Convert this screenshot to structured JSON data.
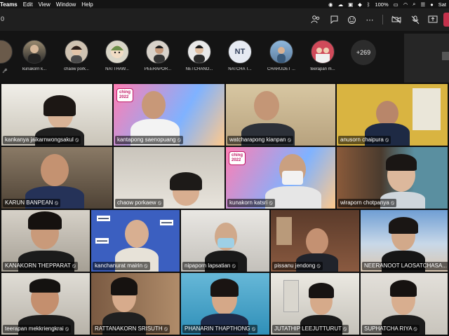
{
  "menubar": {
    "app": "Teams",
    "items": [
      "Edit",
      "View",
      "Window",
      "Help"
    ],
    "battery": "100%",
    "time": "Sat"
  },
  "toolbar": {
    "timer": "0"
  },
  "attendees": [
    {
      "name": "kunakorn k..."
    },
    {
      "name": "chaow pork..."
    },
    {
      "name": "NATTHAW..."
    },
    {
      "name": "PEERAPOR..."
    },
    {
      "name": "NETCHANO..."
    },
    {
      "name": "NATCHA T...",
      "initials": "NT"
    },
    {
      "name": "CHARUDET ..."
    },
    {
      "name": "teerapan m..."
    }
  ],
  "more_count": "+269",
  "badge": {
    "line1": "ching",
    "line2": "2022"
  },
  "tiles": [
    {
      "name": "kankanya jaikarnwongsakul"
    },
    {
      "name": "kantapong saenopuang"
    },
    {
      "name": "watcharapong kianpan"
    },
    {
      "name": "anusorn chaipura"
    },
    {
      "name": "KARUN BANPEAN"
    },
    {
      "name": "chaow porkaew"
    },
    {
      "name": "kunakorn katsri"
    },
    {
      "name": "wiraporn chotpanya"
    },
    {
      "name": "KANAKORN THEPPARAT"
    },
    {
      "name": "kanchanurat mairin"
    },
    {
      "name": "nipaporn lapsatian"
    },
    {
      "name": "pissanu jendong"
    },
    {
      "name": "NEERANOOT LAOSATCHASA..."
    },
    {
      "name": "teerapan mekkriengkrai"
    },
    {
      "name": "RATTANAKORN SRISUTH"
    },
    {
      "name": "PHANARIN THAPTHONG"
    },
    {
      "name": "JUTATHIP LEEJUTTURUT"
    },
    {
      "name": "SUPHATCHA RIYA"
    }
  ],
  "colors": {
    "leave": "#c4314b",
    "badge": "#c11a66"
  }
}
